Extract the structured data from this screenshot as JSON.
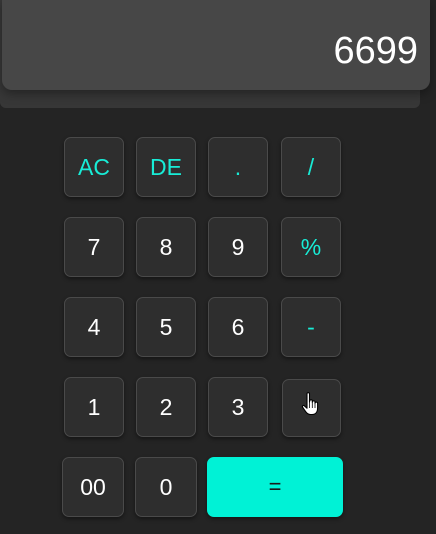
{
  "display": {
    "value": "6699"
  },
  "keys": {
    "ac": "AC",
    "de": "DE",
    "dot": ".",
    "divide": "/",
    "seven": "7",
    "eight": "8",
    "nine": "9",
    "percent": "%",
    "four": "4",
    "five": "5",
    "six": "6",
    "minus": "-",
    "one": "1",
    "two": "2",
    "three": "3",
    "multiply": "",
    "double_zero": "00",
    "zero": "0",
    "equals": "="
  },
  "colors": {
    "accent": "#18ecd6",
    "equals_bg": "#00f2d6",
    "background": "#242424",
    "display_bg": "#474747"
  },
  "icons": {
    "cursor": "hand-pointer-icon"
  }
}
